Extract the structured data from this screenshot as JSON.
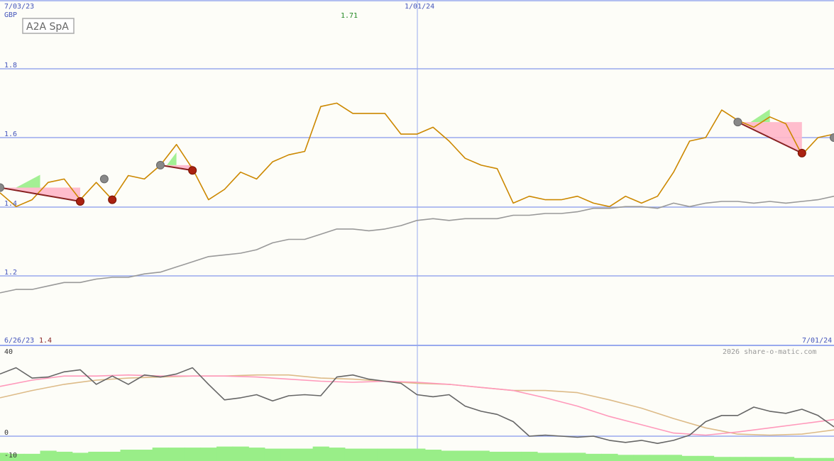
{
  "chart_data": [
    {
      "type": "line",
      "title": "A2A SpA",
      "currency": "GBP",
      "start_date_label": "7/03/23",
      "mid_date_label": "1/01/24",
      "end_date_label": "7/01/24",
      "min_date_label": "6/26/23",
      "min_value_label": "1.4",
      "max_value_label": "1.71",
      "y_ticks": [
        "1.8",
        "1.6",
        "1.4",
        "1.2"
      ],
      "ylim": [
        1.01,
        1.99
      ],
      "xlim": [
        0,
        52
      ],
      "series": [
        {
          "color": "#cc8800",
          "x": [
            0,
            1,
            2,
            3,
            4,
            5,
            6,
            7,
            8,
            9,
            10,
            11,
            12,
            13,
            14,
            15,
            16,
            17,
            18,
            19,
            20,
            21,
            22,
            23,
            24,
            25,
            26,
            27,
            28,
            29,
            30,
            31,
            32,
            33,
            34,
            35,
            36,
            37,
            38,
            39,
            40,
            41,
            42,
            43,
            44,
            45,
            46,
            47,
            48,
            49,
            50,
            51,
            52
          ],
          "y": [
            1.44,
            1.4,
            1.42,
            1.47,
            1.48,
            1.42,
            1.47,
            1.42,
            1.49,
            1.48,
            1.52,
            1.58,
            1.51,
            1.42,
            1.45,
            1.5,
            1.48,
            1.53,
            1.55,
            1.56,
            1.69,
            1.7,
            1.67,
            1.67,
            1.67,
            1.61,
            1.61,
            1.63,
            1.59,
            1.54,
            1.52,
            1.51,
            1.41,
            1.43,
            1.42,
            1.42,
            1.43,
            1.41,
            1.4,
            1.43,
            1.41,
            1.43,
            1.5,
            1.59,
            1.6,
            1.68,
            1.65,
            1.63,
            1.66,
            1.64,
            1.55,
            1.6,
            1.61
          ]
        },
        {
          "color": "#999999",
          "x": [
            0,
            1,
            2,
            3,
            4,
            5,
            6,
            7,
            8,
            9,
            10,
            11,
            12,
            13,
            14,
            15,
            16,
            17,
            18,
            19,
            20,
            21,
            22,
            23,
            24,
            25,
            26,
            27,
            28,
            29,
            30,
            31,
            32,
            33,
            34,
            35,
            36,
            37,
            38,
            39,
            40,
            41,
            42,
            43,
            44,
            45,
            46,
            47,
            48,
            49,
            50,
            51,
            52
          ],
          "y": [
            1.15,
            1.16,
            1.16,
            1.17,
            1.18,
            1.18,
            1.19,
            1.195,
            1.195,
            1.205,
            1.21,
            1.225,
            1.24,
            1.255,
            1.26,
            1.265,
            1.275,
            1.295,
            1.305,
            1.305,
            1.32,
            1.335,
            1.335,
            1.33,
            1.335,
            1.345,
            1.36,
            1.365,
            1.36,
            1.365,
            1.365,
            1.365,
            1.375,
            1.375,
            1.38,
            1.38,
            1.385,
            1.395,
            1.395,
            1.4,
            1.4,
            1.395,
            1.41,
            1.4,
            1.41,
            1.415,
            1.415,
            1.41,
            1.415,
            1.41,
            1.415,
            1.42,
            1.43
          ]
        }
      ],
      "markers": [
        {
          "x": 0,
          "y": 1.455,
          "kind": "peak"
        },
        {
          "x": 5,
          "y": 1.415,
          "kind": "trough"
        },
        {
          "x": 6.5,
          "y": 1.48,
          "kind": "peak"
        },
        {
          "x": 7,
          "y": 1.42,
          "kind": "trough"
        },
        {
          "x": 10,
          "y": 1.52,
          "kind": "peak"
        },
        {
          "x": 12,
          "y": 1.505,
          "kind": "trough"
        },
        {
          "x": 46,
          "y": 1.645,
          "kind": "peak"
        },
        {
          "x": 50,
          "y": 1.555,
          "kind": "trough"
        },
        {
          "x": 52,
          "y": 1.6,
          "kind": "peak"
        }
      ],
      "trend_lines": [
        {
          "x1": 0,
          "y1": 1.455,
          "x2": 5,
          "y2": 1.415
        },
        {
          "x1": 10,
          "y1": 1.52,
          "x2": 12,
          "y2": 1.505
        },
        {
          "x1": 46,
          "y1": 1.645,
          "x2": 50,
          "y2": 1.555
        }
      ]
    },
    {
      "type": "line",
      "credit": "2026 share-o-matic.com",
      "y_ticks": [
        "40",
        "0",
        "-10"
      ],
      "ylim": [
        -11,
        41
      ],
      "xlim": [
        0,
        52
      ],
      "series": [
        {
          "color": "#666666",
          "x": [
            0,
            1,
            2,
            3,
            4,
            5,
            6,
            7,
            8,
            9,
            10,
            11,
            12,
            13,
            14,
            15,
            16,
            17,
            18,
            19,
            20,
            21,
            22,
            23,
            24,
            25,
            26,
            27,
            28,
            29,
            30,
            31,
            32,
            33,
            34,
            35,
            36,
            37,
            38,
            39,
            40,
            41,
            42,
            43,
            44,
            45,
            46,
            47,
            48,
            49,
            50,
            51,
            52
          ],
          "y": [
            30,
            33,
            28,
            28.5,
            31,
            32,
            25,
            29,
            25,
            29.5,
            28.5,
            30,
            33,
            25,
            17.5,
            18.5,
            20,
            17,
            19.5,
            20,
            19.5,
            28.5,
            29.5,
            27.5,
            26.5,
            25.5,
            20,
            19,
            20,
            14.5,
            12,
            10.5,
            7,
            0,
            0.5,
            0,
            -0.5,
            0,
            -2,
            -3,
            -2,
            -3.5,
            -2,
            0.5,
            7,
            10,
            10,
            14,
            12,
            11,
            13,
            10,
            4.5
          ]
        },
        {
          "color": "#ff99bb",
          "x": [
            0,
            2,
            4,
            6,
            8,
            10,
            12,
            14,
            16,
            18,
            20,
            22,
            24,
            26,
            28,
            30,
            32,
            34,
            36,
            38,
            40,
            42,
            44,
            46,
            48,
            50,
            52
          ],
          "y": [
            24,
            27,
            29,
            29,
            29.5,
            29,
            29,
            29,
            28.5,
            27.5,
            26.5,
            26,
            26.5,
            26,
            25,
            23.5,
            22,
            18.5,
            14.5,
            9.5,
            5.5,
            1.5,
            0.5,
            2,
            4,
            6,
            8
          ]
        },
        {
          "color": "#ddbb88",
          "x": [
            0,
            2,
            4,
            6,
            8,
            10,
            12,
            14,
            16,
            18,
            20,
            22,
            24,
            26,
            28,
            30,
            32,
            34,
            36,
            38,
            40,
            42,
            44,
            46,
            48,
            50,
            52
          ],
          "y": [
            18.5,
            22,
            25,
            27,
            28,
            28.5,
            29,
            29,
            29.5,
            29.5,
            28,
            27.5,
            26.5,
            25.5,
            25,
            23.5,
            22,
            22,
            21,
            17.5,
            13.5,
            8.5,
            4,
            1,
            0.5,
            1,
            3
          ]
        }
      ],
      "histogram": {
        "color": "#99ee88",
        "x": [
          0,
          1,
          2,
          3,
          4,
          5,
          6,
          7,
          8,
          9,
          10,
          11,
          12,
          13,
          14,
          15,
          16,
          17,
          18,
          19,
          20,
          21,
          22,
          23,
          24,
          25,
          26,
          27,
          28,
          29,
          30,
          31,
          32,
          33,
          34,
          35,
          36,
          37,
          38,
          39,
          40,
          41,
          42,
          43,
          44,
          45,
          46,
          47,
          48,
          49,
          50,
          51,
          52
        ],
        "y": [
          -8,
          -8.5,
          -8.5,
          -7,
          -7.5,
          -8,
          -7.5,
          -7.5,
          -6.5,
          -6.5,
          -5.5,
          -5.5,
          -5.5,
          -5.5,
          -5,
          -5,
          -5.5,
          -6,
          -6,
          -6,
          -5,
          -5.5,
          -6,
          -6,
          -6,
          -6,
          -6,
          -6.5,
          -7,
          -7,
          -7,
          -7.5,
          -7.5,
          -7.5,
          -8,
          -8,
          -8,
          -8.5,
          -8.5,
          -9,
          -9,
          -9,
          -9,
          -9.5,
          -9.5,
          -10,
          -10,
          -10,
          -10,
          -10,
          -10.5,
          -10.5,
          -10.5
        ]
      }
    }
  ]
}
